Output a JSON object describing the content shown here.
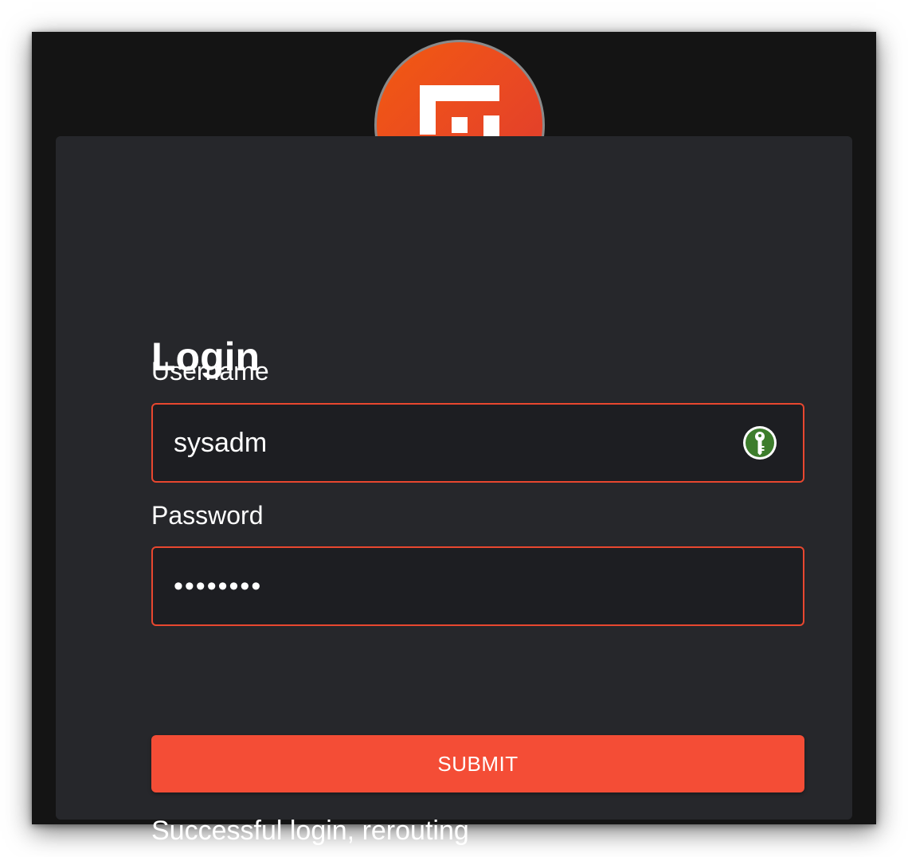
{
  "form": {
    "title": "Login",
    "username_label": "Username",
    "username_value": "sysadm",
    "password_label": "Password",
    "password_value": "sysadmpw",
    "submit_label": "SUBMIT",
    "status_message": "Successful login, rerouting"
  },
  "icons": {
    "logo": "brand-logo-icon",
    "password_manager": "key-icon"
  },
  "colors": {
    "accent": "#f44d36",
    "field_border": "#e8472f",
    "logo_gradient_start": "#f25a10",
    "logo_gradient_end": "#de3a2f",
    "key_icon": "#3d7d2c",
    "window_bg": "#141414",
    "card_bg": "#26272b"
  }
}
